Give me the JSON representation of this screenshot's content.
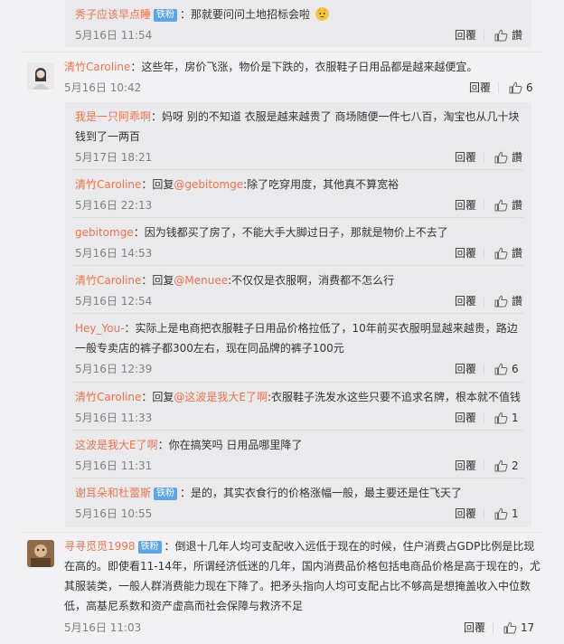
{
  "sub_comments_a": [
    {
      "user": "秀子应该早点睡",
      "badge": "铁粉",
      "text": "：那就要问问土地招标会啦",
      "date": "5月16日 11:54",
      "reply": "回覆",
      "like": "讚"
    }
  ],
  "comment_1": {
    "user": "清竹Caroline",
    "text": "：这些年，房价飞涨，物价是下跌的，衣服鞋子日用品都是越来越便宜。",
    "date": "5月16日 10:42",
    "reply": "回覆",
    "likes": "6"
  },
  "replies_1": [
    {
      "user": "我是一只阿乖啊",
      "line1": "：妈呀 别的不知道 衣服是越来越贵了 商场随便一件七八百，淘宝也从几十块",
      "line2": "钱到了一两百",
      "date": "5月17日 18:21",
      "reply": "回覆",
      "like": "讚"
    },
    {
      "user": "清竹Caroline",
      "pre": "：回复",
      "mention": "@gebitomge",
      "text": ":除了吃穿用度，其他真不算宽裕",
      "date": "5月16日 22:13",
      "reply": "回覆",
      "like": "讚"
    },
    {
      "user": "gebitomge",
      "text": "：因为钱都买了房了，不能大手大脚过日子，那就是物价上不去了",
      "date": "5月16日 14:53",
      "reply": "回覆",
      "like": "讚"
    },
    {
      "user": "清竹Caroline",
      "pre": "：回复",
      "mention": "@Menuee",
      "text": ":不仅仅是衣服啊，消费都不怎么行",
      "date": "5月16日 12:54",
      "reply": "回覆",
      "like": "讚"
    },
    {
      "user": "Hey_You-",
      "line1": "：实际上是电商把衣服鞋子日用品价格拉低了，10年前买衣服明显越来越贵，路边",
      "line2": "一般专卖店的裤子都300左右，现在同品牌的裤子100元",
      "date": "5月16日 12:39",
      "reply": "回覆",
      "likes": "6"
    },
    {
      "user": "清竹Caroline",
      "pre": "：回复",
      "mention": "@这波是我大E了啊",
      "text": ":衣服鞋子洗发水这些只要不追求名牌，根本就不值钱",
      "date": "5月16日 11:33",
      "reply": "回覆",
      "likes": "1"
    },
    {
      "user": "这波是我大E了啊",
      "text": "：你在搞笑吗 日用品哪里降了",
      "date": "5月16日 11:31",
      "reply": "回覆",
      "likes": "2"
    },
    {
      "user": "谢耳朵和杜蕾斯",
      "badge": "铁粉",
      "text": "：是的，其实衣食行的价格涨幅一般，最主要还是住飞天了",
      "date": "5月16日 10:55",
      "reply": "回覆",
      "likes": "1"
    }
  ],
  "comment_2": {
    "user": "寻寻觅觅1998",
    "badge": "铁粉",
    "line1": "：倒退十几年人均可支配收入远低于现在的时候，住户消费占GDP比例是比现",
    "line2": "在高的。即使看11-14年，所谓经济低迷的几年，国内消费品价格包括电商品价格是高于现在的，尤",
    "line3": "其服装类，一般人群消费能力现在下降了。把矛头指向人均可支配占比不够高是想掩盖收入中位数",
    "line4": "低，高基尼系数和资产虚高而社会保障与救济不足",
    "date": "5月16日 11:03",
    "reply": "回覆",
    "likes": "17"
  },
  "colors": {
    "link": "#eb7350",
    "badge": "#5fa4e4",
    "text": "#333333",
    "muted": "#808080",
    "sub_bg": "#eaeaec",
    "bg": "#f2f2f5"
  }
}
